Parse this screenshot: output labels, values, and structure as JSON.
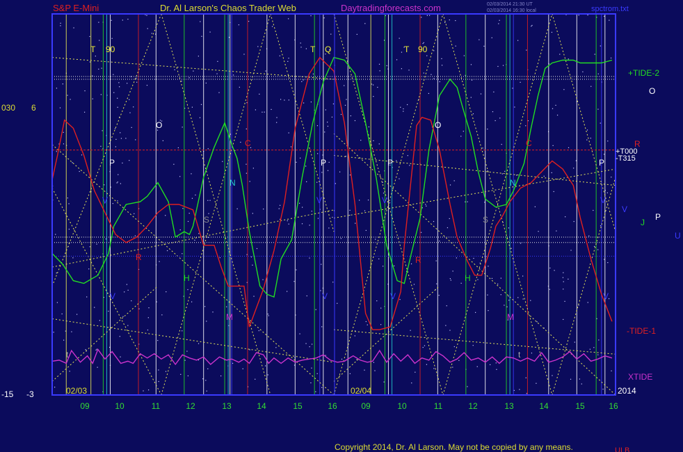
{
  "header": {
    "left": "S&P E-Mini",
    "center": "Dr. Al Larson's Chaos Trader Web",
    "site": "Daytradingforecasts.com",
    "stamp1": "02/03/2014 21:30 UT",
    "stamp2": "02/03/2014 16:30 local",
    "right": "spctrom.txt"
  },
  "footer": {
    "copyright": "Copyright 2014, Dr. Al Larson. May not be copied by any means.",
    "mark": "ULB"
  },
  "colors": {
    "background": "#0b0b5c",
    "plot_border": "#3a3aff",
    "tide2": "#22dd22",
    "tide1": "#e02020",
    "xtide": "#cc33cc",
    "trend_lines": "#e8e85a",
    "level_lines": "#e8e8e8",
    "date_labels": "#dddd33",
    "hour_labels": "#33dd33"
  },
  "left_scale": {
    "top_a": "030",
    "top_b": "6",
    "bottom_a": "-15",
    "bottom_b": "-3"
  },
  "right_labels": {
    "tide2": "+TIDE-2",
    "o": "O",
    "r": "R",
    "t000": "+T000",
    "t315": "-T315",
    "v": "V",
    "j": "J",
    "p": "P",
    "u": "U",
    "tide1": "-TIDE-1",
    "xtide": "XTIDE"
  },
  "x_axis": {
    "date1": "02/03",
    "date2": "02/04",
    "year": "2014",
    "hours": [
      "09",
      "10",
      "11",
      "12",
      "13",
      "14",
      "15",
      "16",
      "09",
      "10",
      "11",
      "12",
      "13",
      "14",
      "15",
      "16"
    ]
  },
  "markers": [
    {
      "text": "T",
      "color": "#eeee33"
    },
    {
      "text": "90",
      "color": "#eeee33"
    },
    {
      "text": "T",
      "color": "#eeee33"
    },
    {
      "text": "Q",
      "color": "#eeee33"
    },
    {
      "text": "T",
      "color": "#eeee33"
    },
    {
      "text": "90",
      "color": "#eeee33"
    },
    {
      "text": "O",
      "color": "#ffffff"
    },
    {
      "text": "O",
      "color": "#ffffff"
    },
    {
      "text": "P",
      "color": "#ffffff"
    },
    {
      "text": "P",
      "color": "#ffffff"
    },
    {
      "text": "P",
      "color": "#ffffff"
    },
    {
      "text": "P",
      "color": "#ffffff"
    },
    {
      "text": "C",
      "color": "#e02020"
    },
    {
      "text": "C",
      "color": "#e02020"
    },
    {
      "text": "N",
      "color": "#22cccc"
    },
    {
      "text": "N",
      "color": "#22cccc"
    },
    {
      "text": "H",
      "color": "#22dd22"
    },
    {
      "text": "H",
      "color": "#22dd22"
    },
    {
      "text": "M",
      "color": "#cc33cc"
    },
    {
      "text": "M",
      "color": "#cc33cc"
    },
    {
      "text": "R",
      "color": "#e02020"
    },
    {
      "text": "R",
      "color": "#e02020"
    },
    {
      "text": "S",
      "color": "#888888"
    },
    {
      "text": "S",
      "color": "#888888"
    },
    {
      "text": "V",
      "color": "#3a3aff"
    },
    {
      "text": "V",
      "color": "#3a3aff"
    },
    {
      "text": "V",
      "color": "#3a3aff"
    },
    {
      "text": "V",
      "color": "#3a3aff"
    },
    {
      "text": "V",
      "color": "#3a3aff"
    },
    {
      "text": "V",
      "color": "#3a3aff"
    },
    {
      "text": "V",
      "color": "#3a3aff"
    },
    {
      "text": "V",
      "color": "#3a3aff"
    },
    {
      "text": "t",
      "color": "#aaaaaa"
    },
    {
      "text": "t",
      "color": "#aaaaaa"
    }
  ],
  "chart_data": {
    "type": "line",
    "title": "Dr. Al Larson's Chaos Trader Web",
    "xlabel": "",
    "ylabel": "",
    "grid": false,
    "x_ticks": [
      "09",
      "10",
      "11",
      "12",
      "13",
      "14",
      "15",
      "16",
      "09",
      "10",
      "11",
      "12",
      "13",
      "14",
      "15",
      "16"
    ],
    "series": [
      {
        "name": "+TIDE-2",
        "color": "#22dd22",
        "x": [
          0.0,
          0.3,
          0.6,
          0.9,
          1.3,
          1.6,
          1.75,
          2.1,
          2.5,
          2.7,
          3.0,
          3.3,
          3.5,
          3.75,
          3.9,
          4.0,
          4.3,
          4.6,
          4.9,
          5.1,
          5.25,
          5.4,
          5.6,
          5.9,
          6.1,
          6.3,
          6.5,
          6.8,
          7.1,
          7.4,
          7.7,
          8.0,
          8.3,
          8.6,
          8.9,
          9.2,
          9.5,
          9.8,
          10.0,
          10.2,
          10.45,
          10.7,
          11.0,
          11.3,
          11.5,
          11.65,
          11.9,
          12.1,
          12.3,
          12.6,
          12.9,
          13.1,
          13.4,
          13.6,
          13.8,
          14.0,
          14.2,
          14.5,
          14.8,
          15.0,
          15.3,
          15.6,
          15.9
        ],
        "y": [
          -1.8,
          -2.2,
          -2.8,
          -2.9,
          -2.6,
          -1.8,
          -0.8,
          0.0,
          0.1,
          0.3,
          0.8,
          0.1,
          -1.2,
          -1.0,
          -1.1,
          -0.8,
          1.0,
          2.1,
          3.0,
          2.2,
          1.7,
          0.7,
          -1.0,
          -3.0,
          -3.3,
          -3.4,
          -2.0,
          -1.3,
          1.0,
          3.0,
          4.5,
          5.4,
          5.3,
          4.8,
          3.0,
          1.0,
          -1.5,
          -2.8,
          -2.9,
          -1.8,
          -0.5,
          2.0,
          4.0,
          4.6,
          4.3,
          3.6,
          2.5,
          1.2,
          0.2,
          -0.1,
          0.0,
          0.5,
          1.5,
          2.8,
          4.0,
          5.0,
          5.2,
          5.3,
          5.3,
          5.2,
          5.2,
          5.2,
          5.3
        ]
      },
      {
        "name": "-TIDE-1",
        "color": "#e02020",
        "x": [
          0.0,
          0.15,
          0.35,
          0.6,
          0.9,
          1.2,
          1.5,
          1.8,
          2.1,
          2.4,
          2.7,
          3.0,
          3.3,
          3.6,
          4.0,
          4.3,
          4.6,
          4.8,
          5.0,
          5.2,
          5.45,
          5.6,
          6.0,
          6.3,
          6.6,
          6.9,
          7.3,
          7.6,
          8.0,
          8.3,
          8.6,
          8.9,
          9.1,
          9.3,
          9.6,
          9.9,
          10.0,
          10.2,
          10.35,
          10.5,
          10.75,
          11.0,
          11.3,
          11.5,
          11.8,
          12.0,
          12.2,
          12.45,
          12.6,
          12.8,
          13.0,
          13.3,
          13.6,
          13.9,
          14.2,
          14.5,
          14.8,
          15.0,
          15.3,
          15.6,
          15.9
        ],
        "y": [
          0.9,
          1.8,
          3.1,
          2.8,
          1.8,
          0.5,
          -0.3,
          -1.1,
          -1.4,
          -1.2,
          -0.8,
          -0.3,
          0.0,
          0.0,
          -0.2,
          -1.5,
          -1.5,
          -2.3,
          -3.0,
          -3.0,
          -3.0,
          -4.5,
          -3.1,
          -1.7,
          0.1,
          2.8,
          4.8,
          5.4,
          4.9,
          3.0,
          0.0,
          -4.0,
          -4.6,
          -4.6,
          -4.5,
          -3.2,
          -1.5,
          1.0,
          2.9,
          3.2,
          3.1,
          2.0,
          0.0,
          -1.2,
          -2.1,
          -2.6,
          -2.6,
          -1.6,
          -0.8,
          -0.4,
          0.1,
          0.6,
          0.8,
          1.2,
          1.6,
          1.3,
          0.7,
          -0.5,
          -2.0,
          -3.3,
          -4.3
        ]
      },
      {
        "name": "XTIDE",
        "color": "#cc33cc",
        "x": [
          0.0,
          0.2,
          0.4,
          0.55,
          0.8,
          1.0,
          1.15,
          1.3,
          1.5,
          1.7,
          1.95,
          2.15,
          2.3,
          2.5,
          2.7,
          2.9,
          3.1,
          3.3,
          3.5,
          3.7,
          3.9,
          4.1,
          4.3,
          4.5,
          4.75,
          4.95,
          5.1,
          5.3,
          5.45,
          5.6,
          5.8,
          6.0,
          6.15,
          6.3,
          6.5,
          6.7,
          6.9,
          7.1,
          7.3,
          7.5,
          7.7,
          7.9,
          8.1,
          8.3,
          8.55,
          8.75,
          8.95,
          9.1,
          9.3,
          9.5,
          9.7,
          9.9,
          10.1,
          10.3,
          10.5,
          10.7,
          10.9,
          11.1,
          11.3,
          11.5,
          11.7,
          11.9,
          12.1,
          12.3,
          12.5,
          12.7,
          12.9,
          13.1,
          13.3,
          13.5,
          13.7,
          13.9,
          14.1,
          14.3,
          14.5,
          14.7,
          14.9,
          15.1,
          15.3,
          15.5,
          15.7,
          15.9
        ],
        "y": [
          0.3,
          0.4,
          0.1,
          1.3,
          0.2,
          0.8,
          0.1,
          1.4,
          0.5,
          1.2,
          0.1,
          0.3,
          0.1,
          1.0,
          0.6,
          1.0,
          0.5,
          0.9,
          0.0,
          0.9,
          0.6,
          0.4,
          0.7,
          0.0,
          0.7,
          0.4,
          0.5,
          0.2,
          0.5,
          0.1,
          1.1,
          0.9,
          0.1,
          0.6,
          0.1,
          0.6,
          0.2,
          0.4,
          0.5,
          0.6,
          0.9,
          0.4,
          0.2,
          0.3,
          0.8,
          0.4,
          0.2,
          0.3,
          1.3,
          0.2,
          1.0,
          0.3,
          0.9,
          0.1,
          0.6,
          0.4,
          1.2,
          0.8,
          0.2,
          0.5,
          1.1,
          0.4,
          0.6,
          0.2,
          0.7,
          0.1,
          0.7,
          0.6,
          0.3,
          0.6,
          0.3,
          1.1,
          0.2,
          0.4,
          0.7,
          1.2,
          0.5,
          1.0,
          0.3,
          0.5,
          0.8,
          0.6
        ]
      }
    ],
    "ylim": [
      -7,
      7
    ],
    "xtide_ylim": [
      -3,
      3
    ]
  }
}
